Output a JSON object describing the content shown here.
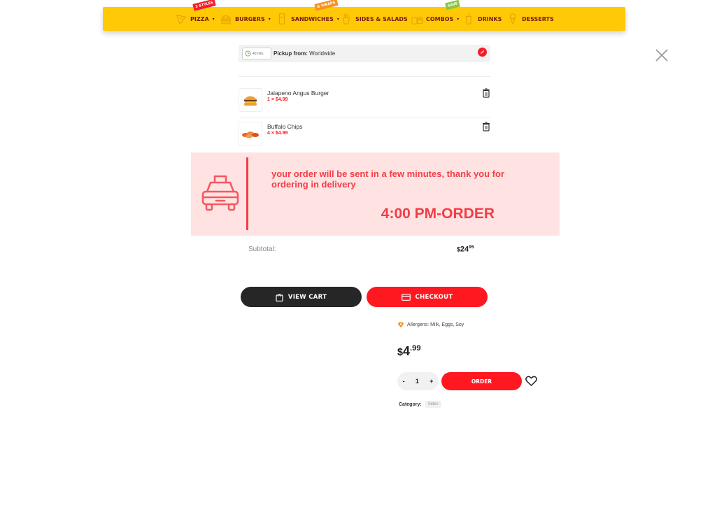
{
  "nav": {
    "items": [
      {
        "label": "PIZZA",
        "caret": "▾",
        "badge": "3 STYLES",
        "icon": "pizza-icon"
      },
      {
        "label": "BURGERS",
        "caret": "▾",
        "icon": "burger-icon"
      },
      {
        "label": "SANDWICHES",
        "caret": "▾",
        "badge": "& WRAPS",
        "icon": "sandwich-icon"
      },
      {
        "label": "SIDES & SALADS",
        "icon": "fries-icon"
      },
      {
        "label": "COMBOS",
        "caret": "▾",
        "badge": "SAVE",
        "icon": "combo-icon"
      },
      {
        "label": "DRINKS",
        "icon": "drink-icon"
      },
      {
        "label": "DESSERTS",
        "icon": "ice-cream-icon"
      }
    ],
    "colors": {
      "bar": "#ffc906",
      "text": "#7a1a10",
      "badge_red": "#f2202a",
      "badge_orange": "#f7941d",
      "badge_green": "#8cc63f"
    }
  },
  "cart": {
    "pickup": {
      "time": "40 min.",
      "label": "Pickup from:",
      "value": "Worldwide"
    },
    "items": [
      {
        "name": "Jalapeno Angus Burger",
        "price": "1 × $4.99",
        "icon": "burger-icon"
      },
      {
        "name": "Buffalo Chips",
        "price": "4 × $4.99",
        "icon": "chips-icon"
      }
    ],
    "subtotal_label": "Subtotal:",
    "subtotal_currency": "$",
    "subtotal_whole": "24",
    "subtotal_cents": "95",
    "view_cart_label": "VIEW CART",
    "checkout_label": "CHECKOUT"
  },
  "notice": {
    "message": "your order will be sent in a few minutes, thank you for ordering in delivery",
    "order_time": "4:00 PM-ORDER",
    "icon": "taxi-icon",
    "colors": {
      "background": "#ffe3e3",
      "accent": "#f23d47"
    }
  },
  "product": {
    "allergens": "Allergens: Milk, Eggs, Soy",
    "price_currency": "$",
    "price_whole": "4",
    "price_cents": ".99",
    "quantity": "1",
    "minus": "-",
    "plus": "+",
    "order_label": "ORDER",
    "category_label": "Category:",
    "category_value": "Sides"
  },
  "colors": {
    "primary_red": "#ff1820",
    "dark": "#262626"
  }
}
